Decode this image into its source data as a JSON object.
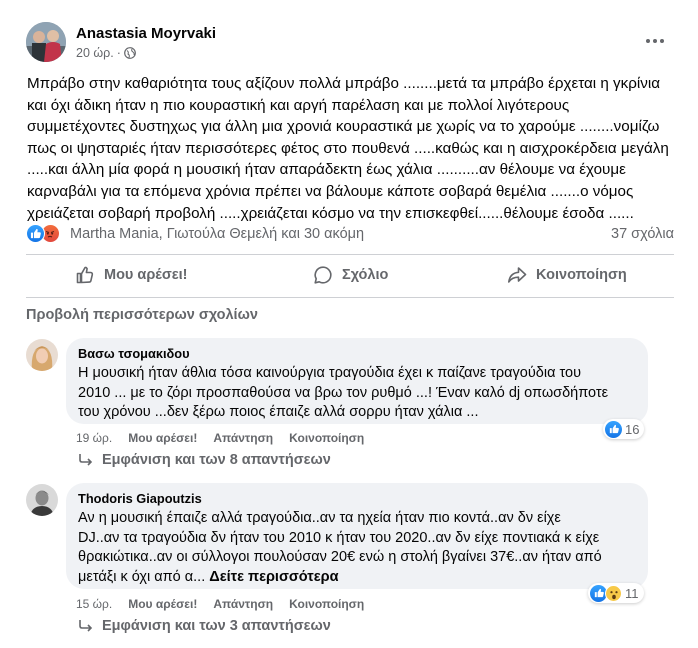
{
  "post": {
    "author": "Anastasia Moyrvaki",
    "time": "20 ώρ.",
    "dot": "·",
    "text_lines": [
      "Μπράβο στην καθαριότητα τους αξίζουν πολλά μπράβο ........μετά τα μπράβο έρχεται η γκρίνια",
      "και όχι άδικη ήταν η πιο κουραστική και αργή παρέλαση και με πολλοί λιγότερους",
      "συμμετέχοντες δυστηχως για άλλη μια χρονιά κουραστικά με χωρίς να το χαρούμε ........νομίζω",
      "πως οι ψησταριές ήταν περισσότερες φέτος στο πουθενά .....καθώς και η αισχροκέρδεια μεγάλη",
      ".....και άλλη μία φορά η μουσική ήταν απαράδεκτη έως χάλια   ..........αν θέλουμε να έχουμε",
      "καρναβάλι για τα επόμενα χρόνια πρέπει να βάλουμε κάποτε σοβαρά θεμέλια .......ο νόμος",
      "χρειάζεται σοβαρή προβολή .....χρειάζεται κόσμο να την επισκεφθεί......θέλουμε έσοδα ......"
    ],
    "reactors": "Martha Mania, Γιωτούλα Θεμελή και 30 ακόμη",
    "comments_count": "37 σχόλια"
  },
  "actions": {
    "like": "Μου αρέσει!",
    "comment": "Σχόλιο",
    "share": "Κοινοποίηση"
  },
  "more_comments": "Προβολή περισσότερων σχολίων",
  "comments": [
    {
      "name": "Βασω τσομακιδου",
      "lines": [
        "Η μουσική ήταν άθλια τόσα καινούργια τραγούδια έχει κ παίζανε τραγούδια του",
        "2010 ... με το ζόρι προσπαθούσα να βρω τον ρυθμό ...! Έναν καλό dj οπωσδήποτε",
        "του χρόνου ...δεν ξέρω ποιος έπαιζε αλλά σορρυ ήταν χάλια ..."
      ],
      "time": "19 ώρ.",
      "like": "Μου αρέσει!",
      "reply": "Απάντηση",
      "share": "Κοινοποίηση",
      "reaction_count": "16",
      "replies": "Εμφάνιση και των 8 απαντήσεων"
    },
    {
      "name": "Thodoris Giapoutzis",
      "lines": [
        "Αν η μουσική έπαιζε αλλά τραγούδια..αν τα ηχεία ήταν πιο κοντά..αν δν είχε",
        "DJ..αν τα τραγούδια δν ήταν του 2010 κ ήταν του 2020..αν δν είχε ποντιακά κ είχε",
        "θρακιώτικα..αν οι σύλλογοι πουλούσαν 20€ ενώ η στολή βγαίνει 37€..αν ήταν από"
      ],
      "last_line": "μετάξι κ όχι από α...",
      "see_more": "Δείτε περισσότερα",
      "time": "15 ώρ.",
      "like": "Μου αρέσει!",
      "reply": "Απάντηση",
      "share": "Κοινοποίηση",
      "reaction_count": "11",
      "replies": "Εμφάνιση και των 3 απαντήσεων"
    }
  ]
}
